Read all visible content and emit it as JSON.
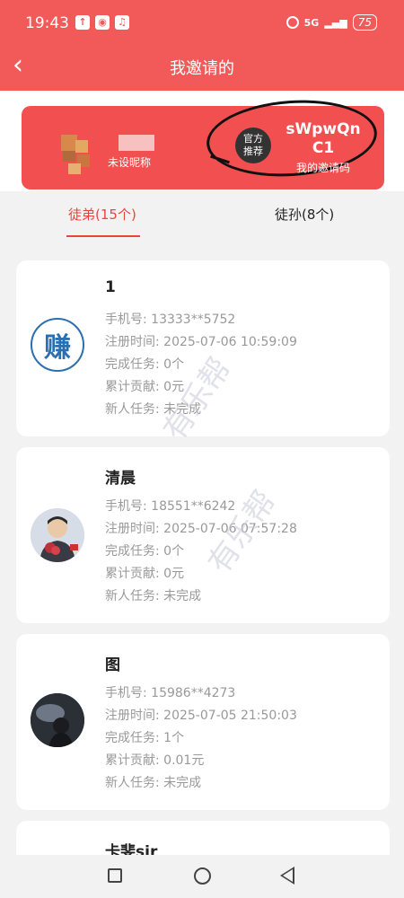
{
  "status_bar": {
    "time": "19:43",
    "network": "5G",
    "battery": "75"
  },
  "header": {
    "back_icon": "chevron-left-icon",
    "title": "我邀请的"
  },
  "invite_card": {
    "nickname": "未设昵称",
    "official_badge": "官方\n推荐",
    "invite_code": "sWpwQn\nC1",
    "invite_label": "我的邀请码"
  },
  "tabs": [
    {
      "label": "徒弟(15个)",
      "active": true
    },
    {
      "label": "徒孙(8个)",
      "active": false
    }
  ],
  "members": [
    {
      "name": "1",
      "phone": "手机号:  13333**5752",
      "register_time": "注册时间:  2025-07-06 10:59:09",
      "tasks": "完成任务:  0个",
      "contribution": "累计贡献:  0元",
      "newbie_task": "新人任务:  未完成",
      "avatar_text": "赚"
    },
    {
      "name": "清晨",
      "phone": "手机号:  18551**6242",
      "register_time": "注册时间:  2025-07-06 07:57:28",
      "tasks": "完成任务:  0个",
      "contribution": "累计贡献:  0元",
      "newbie_task": "新人任务:  未完成"
    },
    {
      "name": "图",
      "phone": "手机号:  15986**4273",
      "register_time": "注册时间:  2025-07-05 21:50:03",
      "tasks": "完成任务:  1个",
      "contribution": "累计贡献:  0.01元",
      "newbie_task": "新人任务:  未完成"
    },
    {
      "name": "卡斐sir"
    }
  ],
  "watermark": "有乐帮",
  "colors": {
    "brand": "#f25a5a",
    "accent": "#e8453c"
  }
}
